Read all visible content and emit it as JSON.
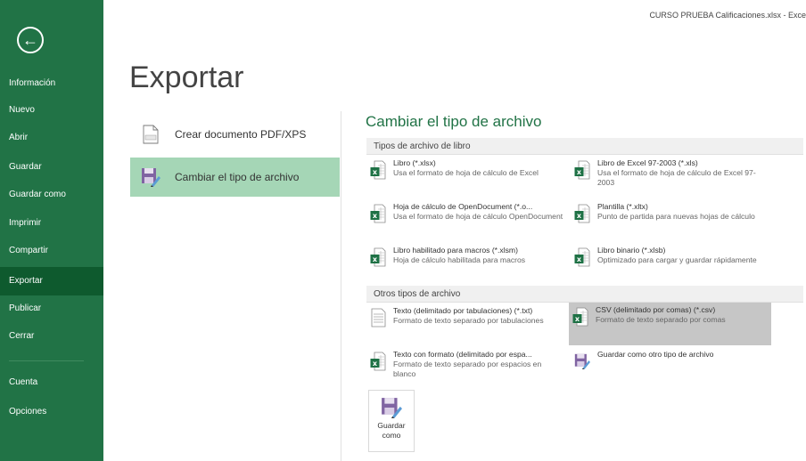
{
  "window": {
    "title": "CURSO PRUEBA Calificaciones.xlsx - Exce"
  },
  "sidebar": {
    "back_icon": "back-arrow-icon",
    "items": [
      {
        "label": "Información"
      },
      {
        "label": "Nuevo"
      },
      {
        "label": "Abrir"
      },
      {
        "label": "Guardar"
      },
      {
        "label": "Guardar como"
      },
      {
        "label": "Imprimir"
      },
      {
        "label": "Compartir"
      },
      {
        "label": "Exportar",
        "active": true
      },
      {
        "label": "Publicar"
      },
      {
        "label": "Cerrar"
      },
      {
        "label": "Cuenta"
      },
      {
        "label": "Opciones"
      }
    ]
  },
  "main": {
    "title": "Exportar",
    "options": [
      {
        "label": "Crear documento PDF/XPS",
        "icon": "pdf-document-icon"
      },
      {
        "label": "Cambiar el tipo de archivo",
        "icon": "save-convert-icon",
        "selected": true
      }
    ]
  },
  "panel": {
    "heading": "Cambiar el tipo de archivo",
    "workbook_group": "Tipos de archivo de libro",
    "other_group": "Otros tipos de archivo",
    "workbook_types": [
      {
        "title": "Libro (*.xlsx)",
        "desc": "Usa el formato de hoja de cálculo de Excel"
      },
      {
        "title": "Libro de Excel 97-2003 (*.xls)",
        "desc": "Usa el formato de hoja de cálculo de Excel 97-2003"
      },
      {
        "title": "Hoja de cálculo de OpenDocument (*.o...",
        "desc": "Usa el formato de hoja de cálculo OpenDocument"
      },
      {
        "title": "Plantilla (*.xltx)",
        "desc": "Punto de partida para nuevas hojas de cálculo"
      },
      {
        "title": "Libro habilitado para macros (*.xlsm)",
        "desc": "Hoja de cálculo habilitada para macros"
      },
      {
        "title": "Libro binario (*.xlsb)",
        "desc": "Optimizado para cargar y guardar rápidamente"
      }
    ],
    "other_types": [
      {
        "title": "Texto (delimitado por tabulaciones) (*.txt)",
        "desc": "Formato de texto separado por tabulaciones"
      },
      {
        "title": "CSV (delimitado por comas) (*.csv)",
        "desc": "Formato de texto separado por comas",
        "selected": true
      },
      {
        "title": "Texto con formato (delimitado por espa...",
        "desc": "Formato de texto separado por espacios en blanco"
      },
      {
        "title": "Guardar como otro tipo de archivo",
        "desc": ""
      }
    ],
    "save_as": {
      "line1": "Guardar",
      "line2": "como"
    }
  },
  "colors": {
    "accent": "#217346",
    "selected_option": "#a5d6b6",
    "selected_type": "#c6c6c6"
  }
}
